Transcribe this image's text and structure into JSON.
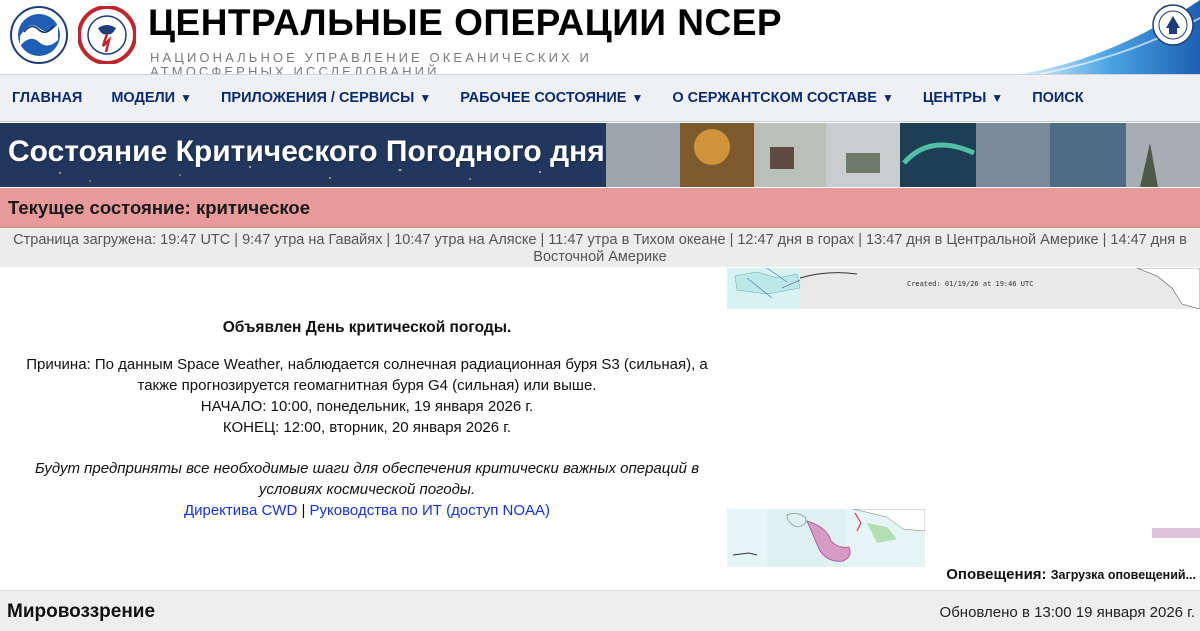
{
  "header": {
    "title": "ЦЕНТРАЛЬНЫЕ ОПЕРАЦИИ NCEP",
    "subtitle": "НАЦИОНАЛЬНОЕ УПРАВЛЕНИЕ ОКЕАНИЧЕСКИХ И АТМОСФЕРНЫХ ИССЛЕДОВАНИЙ",
    "logos": [
      "noaa-logo",
      "nws-logo",
      "department-of-commerce-seal"
    ],
    "colors": {
      "nav_text": "#0b2a6f",
      "status_bg": "#e79a9a",
      "link": "#1733d8"
    }
  },
  "nav": {
    "items": [
      {
        "label": "ГЛАВНАЯ",
        "dropdown": false
      },
      {
        "label": "МОДЕЛИ",
        "dropdown": true
      },
      {
        "label": "ПРИЛОЖЕНИЯ / СЕРВИСЫ",
        "dropdown": true
      },
      {
        "label": "РАБОЧЕЕ СОСТОЯНИЕ",
        "dropdown": true
      },
      {
        "label": "О СЕРЖАНТСКОМ СОСТАВЕ",
        "dropdown": true
      },
      {
        "label": "ЦЕНТРЫ",
        "dropdown": true
      },
      {
        "label": "ПОИСК",
        "dropdown": false
      }
    ],
    "caret": "▼"
  },
  "banner": {
    "title": "Состояние Критического Погодного дня"
  },
  "status": {
    "text": "Текущее состояние: критическое"
  },
  "loaded": {
    "text": "Страница загружена: 19:47 UTC | 9:47 утра на Гавайях | 10:47 утра на Аляске | 11:47 утра в Тихом океане | 12:47 дня в горах | 13:47 дня в Центральной Америке | 14:47 дня в Восточной Америке"
  },
  "message": {
    "heading": "Объявлен День критической погоды.",
    "reason": "Причина: По данным Space Weather, наблюдается солнечная радиационная буря S3 (сильная), а также прогнозируется геомагнитная буря G4 (сильная) или выше.",
    "start": "НАЧАЛО: 10:00, понедельник, 19 января 2026 г.",
    "end": "КОНЕЦ: 12:00, вторник, 20 января 2026 г.",
    "note": "Будут предприняты все необходимые шаги для обеспечения критически важных операций в условиях космической погоды.",
    "link_directive": "Директива CWD",
    "separator": "|",
    "link_guides": "Руководства по ИТ (доступ NOAA)"
  },
  "map": {
    "caption": "Created: 01/19/26 at 19:46 UTC"
  },
  "alerts": {
    "label": "Оповещения:",
    "value": "Загрузка оповещений..."
  },
  "outlook": {
    "title": "Мировоззрение",
    "updated": "Обновлено в 13:00 19 января 2026 г."
  }
}
